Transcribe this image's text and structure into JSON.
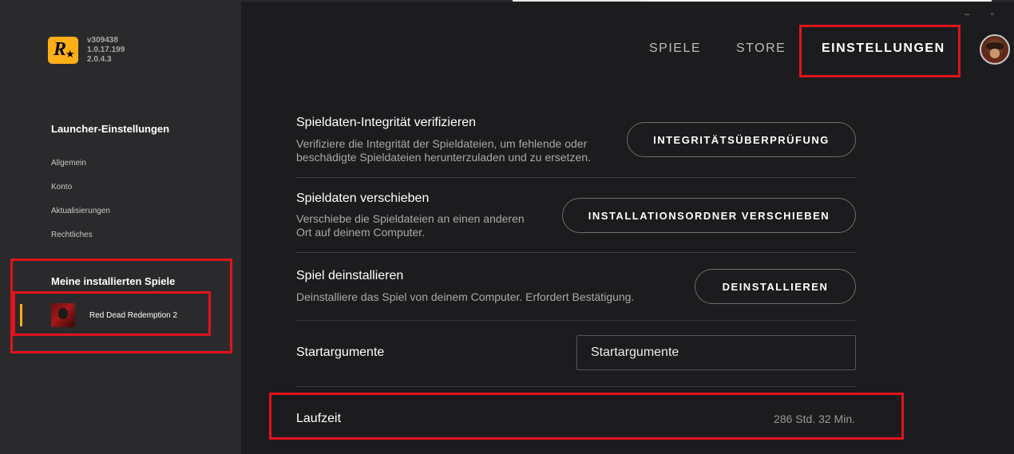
{
  "app": {
    "versions": [
      "v309438",
      "1.0.17.199",
      "2.0.4.3"
    ]
  },
  "window": {
    "minimize": "–",
    "maximize": "▫"
  },
  "nav": {
    "games": "SPIELE",
    "store": "STORE",
    "settings": "EINSTELLUNGEN"
  },
  "sidebar": {
    "launcher_title": "Launcher-Einstellungen",
    "links": [
      "Allgemein",
      "Konto",
      "Aktualisierungen",
      "Rechtliches"
    ],
    "installed_title": "Meine installierten Spiele",
    "game_name": "Red Dead Redemption 2"
  },
  "settings": {
    "verify": {
      "title": "Spieldaten-Integrität verifizieren",
      "desc1": "Verifiziere die Integrität der Spieldateien, um fehlende oder",
      "desc2": "beschädigte Spieldateien herunterzuladen und zu ersetzen.",
      "button": "INTEGRITÄTSÜBERPRÜFUNG"
    },
    "move": {
      "title": "Spieldaten verschieben",
      "desc1": "Verschiebe die Spieldateien an einen anderen",
      "desc2": "Ort auf deinem Computer.",
      "button": "INSTALLATIONSORDNER VERSCHIEBEN"
    },
    "uninstall": {
      "title": "Spiel deinstallieren",
      "desc": "Deinstalliere das Spiel von deinem Computer. Erfordert Bestätigung.",
      "button": "DEINSTALLIEREN"
    },
    "args": {
      "title": "Startargumente",
      "placeholder": "Startargumente"
    },
    "runtime": {
      "title": "Laufzeit",
      "value": "286 Std. 32 Min."
    }
  },
  "colors": {
    "accent": "#fcaf17",
    "highlight": "#e0141b",
    "sidebar_bg": "#2a2a2d",
    "main_bg": "#1c1c1f"
  },
  "icons": {
    "logo": "rockstar-logo-icon",
    "avatar": "user-avatar-icon"
  }
}
